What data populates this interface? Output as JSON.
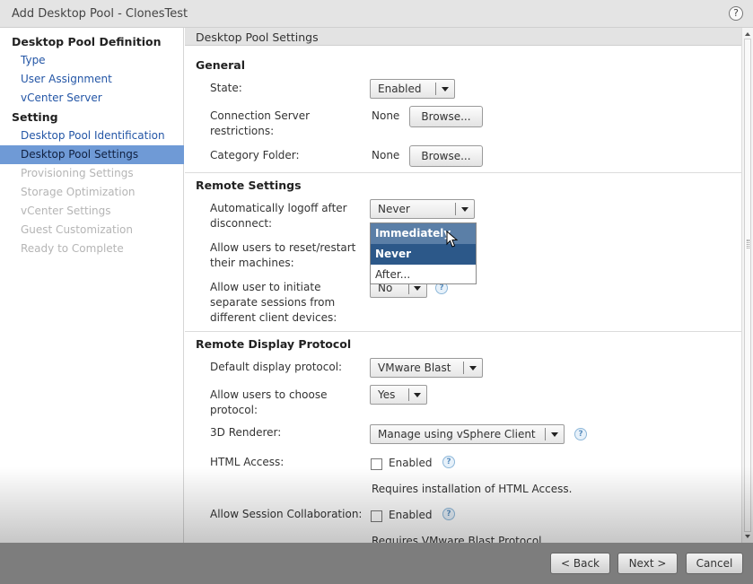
{
  "window": {
    "title": "Add Desktop Pool - ClonesTest",
    "help_label": "?"
  },
  "sidebar": {
    "items": [
      {
        "label": "Desktop Pool Definition",
        "kind": "head"
      },
      {
        "label": "Type",
        "kind": "link"
      },
      {
        "label": "User Assignment",
        "kind": "link"
      },
      {
        "label": "vCenter Server",
        "kind": "link"
      },
      {
        "label": "Setting",
        "kind": "head"
      },
      {
        "label": "Desktop Pool Identification",
        "kind": "link"
      },
      {
        "label": "Desktop Pool Settings",
        "kind": "active"
      },
      {
        "label": "Provisioning Settings",
        "kind": "disabled"
      },
      {
        "label": "Storage Optimization",
        "kind": "disabled"
      },
      {
        "label": "vCenter Settings",
        "kind": "disabled"
      },
      {
        "label": "Guest Customization",
        "kind": "disabled"
      },
      {
        "label": "Ready to Complete",
        "kind": "disabled"
      }
    ]
  },
  "main": {
    "section_title": "Desktop Pool Settings",
    "general": {
      "title": "General",
      "state_label": "State:",
      "state_value": "Enabled",
      "conn_label": "Connection Server restrictions:",
      "conn_value": "None",
      "conn_browse": "Browse...",
      "cat_label": "Category Folder:",
      "cat_value": "None",
      "cat_browse": "Browse..."
    },
    "remote": {
      "title": "Remote Settings",
      "logoff_label": "Automatically logoff after disconnect:",
      "logoff_value": "Never",
      "logoff_options": [
        "Immediately",
        "Never",
        "After..."
      ],
      "reset_label": "Allow users to reset/restart their machines:",
      "sessions_label": "Allow user to initiate separate sessions from different client devices:",
      "sessions_value": "No"
    },
    "display": {
      "title": "Remote Display Protocol",
      "protocol_label": "Default display protocol:",
      "protocol_value": "VMware Blast",
      "choose_label": "Allow users to choose protocol:",
      "choose_value": "Yes",
      "renderer_label": "3D Renderer:",
      "renderer_value": "Manage using vSphere Client",
      "html_label": "HTML Access:",
      "html_enabled_label": "Enabled",
      "html_note": "Requires installation of HTML Access.",
      "collab_label": "Allow Session Collaboration:",
      "collab_enabled_label": "Enabled",
      "collab_note": "Requires VMware Blast Protocol"
    }
  },
  "footer": {
    "back": "< Back",
    "next": "Next >",
    "cancel": "Cancel"
  },
  "icons": {
    "info": "info-icon",
    "help": "help-icon",
    "cursor": "mouse-pointer-icon"
  }
}
